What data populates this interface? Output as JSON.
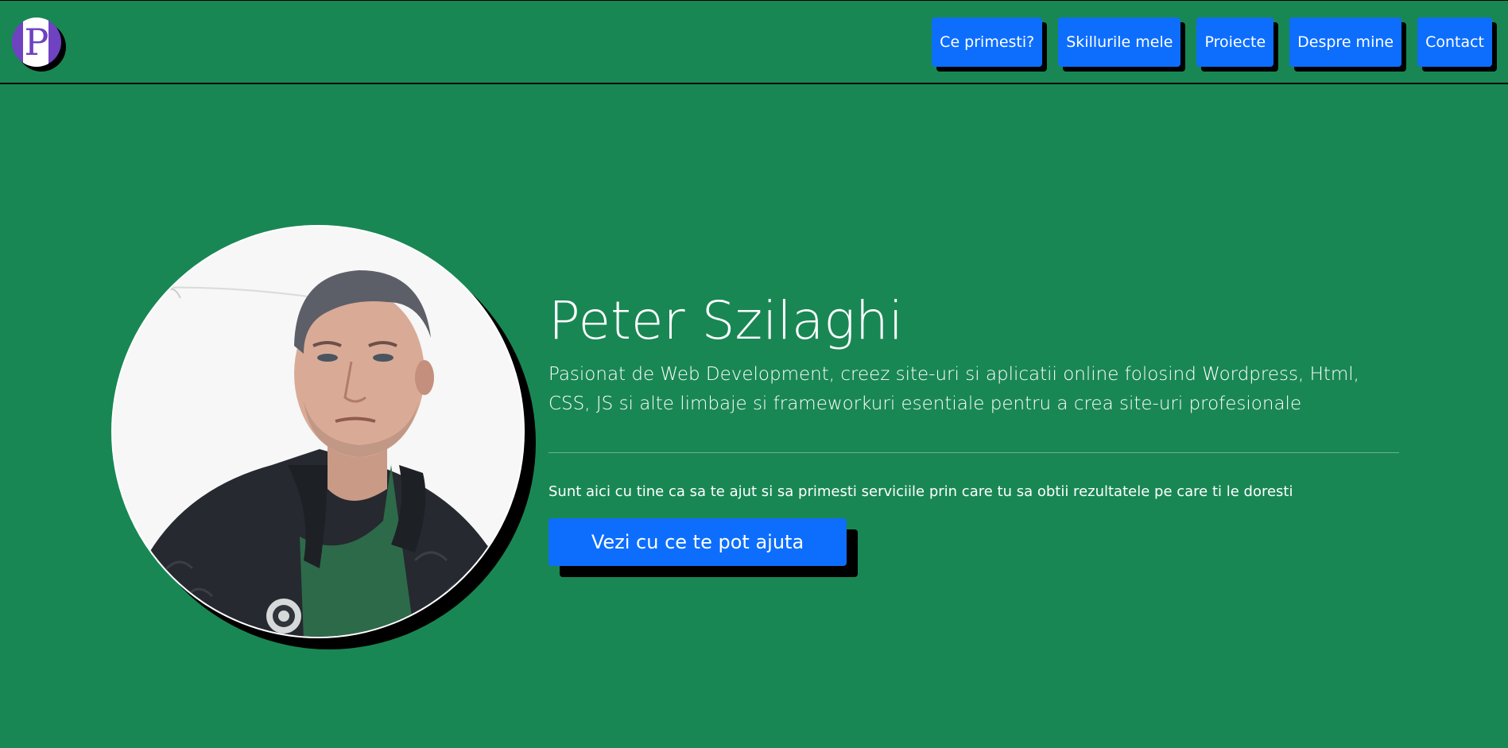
{
  "brand": {
    "logo_letter": "P",
    "logo_icon": "letter-p-logo-icon"
  },
  "nav": {
    "items": [
      {
        "label": "Ce primesti?"
      },
      {
        "label": "Skillurile mele"
      },
      {
        "label": "Proiecte"
      },
      {
        "label": "Despre mine"
      },
      {
        "label": "Contact"
      }
    ]
  },
  "hero": {
    "name": "Peter Szilaghi",
    "lead": "Pasionat de Web Development, creez site-uri si aplicatii online folosind Wordpress, Html, CSS, JS si alte limbaje si frameworkuri esentiale pentru a crea site-uri profesionale",
    "subtext": "Sunt aici cu tine ca sa te ajut si sa primesti serviciile prin care tu sa obtii rezultatele pe care ti le doresti",
    "cta_label": "Vezi cu ce te pot ajuta"
  },
  "colors": {
    "background": "#198754",
    "button": "#0d6efd",
    "shadow": "#000000",
    "text": "#ffffff",
    "logo": "#6f42c1"
  }
}
